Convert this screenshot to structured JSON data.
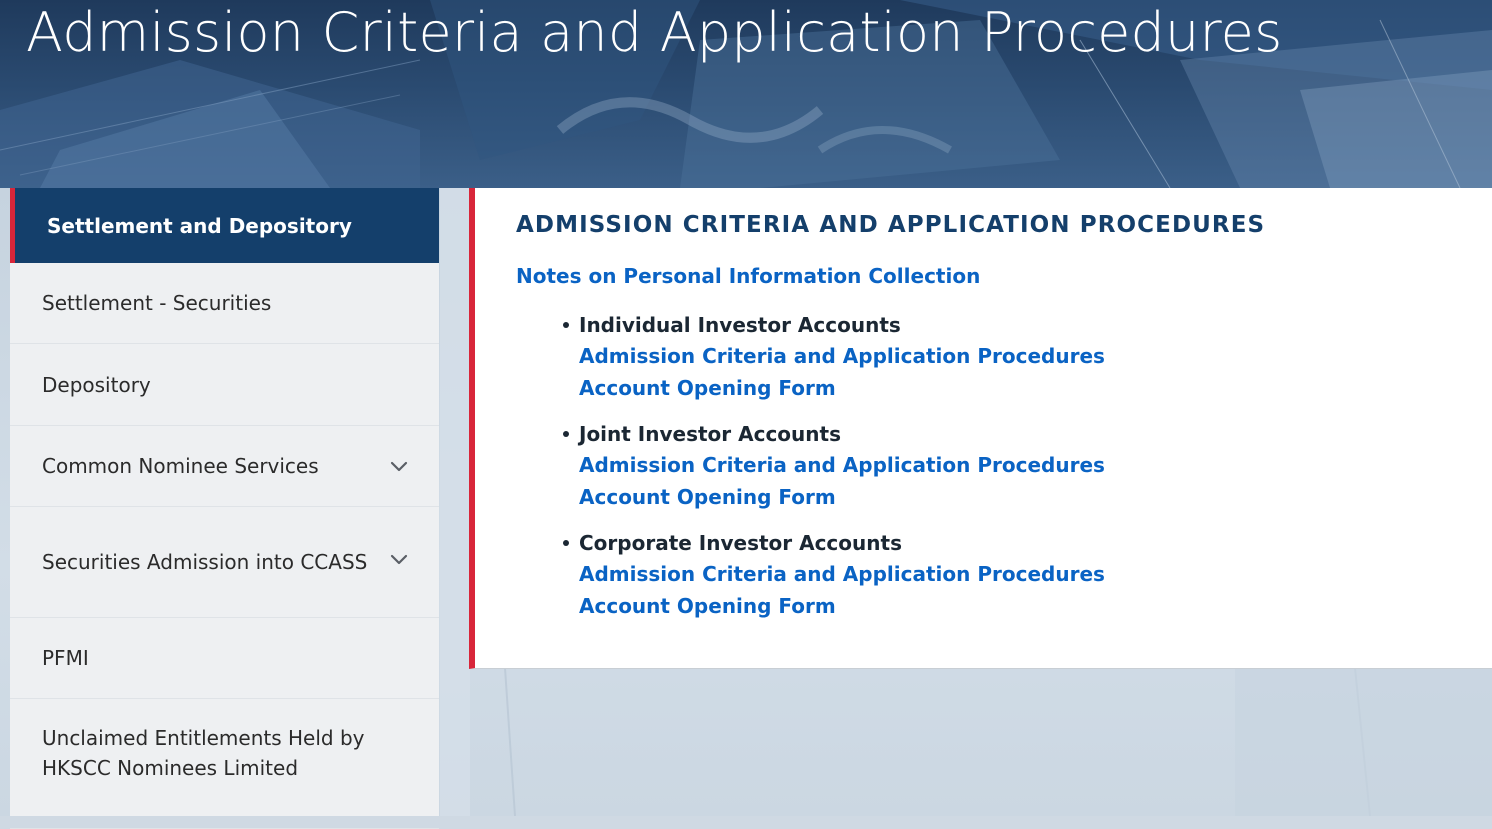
{
  "hero": {
    "title": "Admission Criteria and Application Procedures"
  },
  "sidebar": {
    "header": "Settlement and Depository",
    "items": [
      {
        "label": "Settlement - Securities",
        "expandable": false
      },
      {
        "label": "Depository",
        "expandable": false
      },
      {
        "label": "Common Nominee Services",
        "expandable": true,
        "icon": "chevron-down-icon"
      },
      {
        "label": "Securities Admission into CCASS",
        "expandable": true,
        "icon": "chevron-down-icon"
      },
      {
        "label": "PFMI",
        "expandable": false
      },
      {
        "label": "Unclaimed Entitlements Held by HKSCC Nominees Limited",
        "expandable": false
      }
    ]
  },
  "main": {
    "heading": "ADMISSION CRITERIA AND APPLICATION PROCEDURES",
    "notes_link": "Notes on Personal Information Collection",
    "accounts": [
      {
        "name": "Individual Investor Accounts",
        "links": [
          "Admission Criteria and Application Procedures",
          "Account Opening Form"
        ]
      },
      {
        "name": "Joint Investor Accounts",
        "links": [
          "Admission Criteria and Application Procedures",
          "Account Opening Form"
        ]
      },
      {
        "name": "Corporate Investor Accounts",
        "links": [
          "Admission Criteria and Application Procedures",
          "Account Opening Form"
        ]
      }
    ]
  },
  "colors": {
    "navy": "#143f6b",
    "accent_red": "#d8263a",
    "link_blue": "#0a63c4",
    "sidebar_bg": "#eef0f2",
    "text_dark": "#1b2733"
  }
}
